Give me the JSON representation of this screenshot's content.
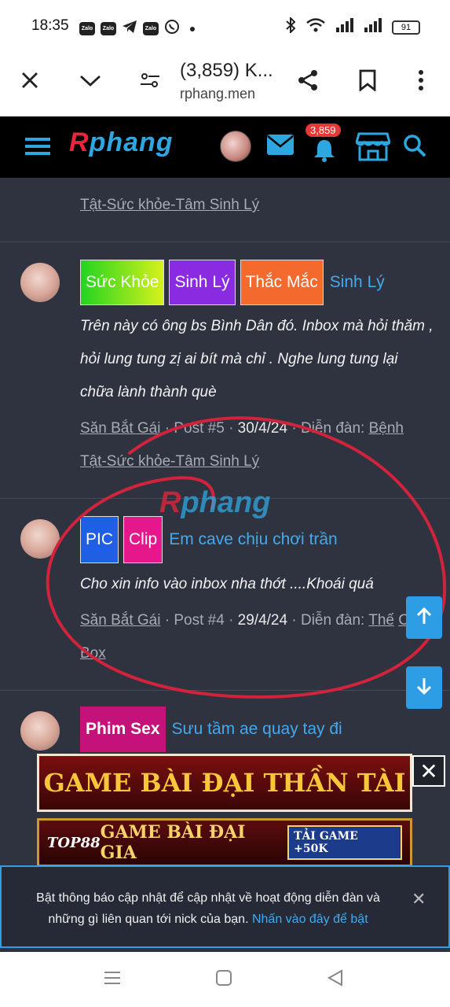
{
  "status_bar": {
    "time": "18:35",
    "app_icons": [
      "zalo-icon",
      "zalo-icon",
      "telegram-icon",
      "zalo-icon",
      "viber-icon"
    ],
    "app_labels": [
      "Zalo",
      "Zalo",
      "",
      "Zalo",
      ""
    ],
    "battery": "91"
  },
  "browser": {
    "title": "(3,859) K...",
    "url": "rphang.men"
  },
  "site_header": {
    "logo_r": "R",
    "logo_rest": "phang",
    "notification_count": "3,859"
  },
  "posts": [
    {
      "meta_link": "Tật-Sức khỏe-Tâm Sinh Lý"
    },
    {
      "tags": [
        {
          "label": "Sức Khỏe",
          "color": "#6fdc1e"
        },
        {
          "label": "Sinh Lý",
          "color": "#9b2fe0"
        },
        {
          "label": "Thắc Mắc",
          "color": "#f46a2e"
        }
      ],
      "thread_title": "Sinh Lý",
      "snippet": "Trên này có ông bs Bình Dân đó. Inbox mà hỏi thăm , hỏi lung tung zị ai bít mà chỉ . Nghe lung tung lại chữa lành thành què",
      "author": "Săn Bắt Gái",
      "post_no": "Post #5",
      "date": "30/4/24",
      "forum_label": "Diễn đàn:",
      "forum_line1": "Bệnh",
      "forum_line2": "Tật-Sức khỏe-Tâm Sinh Lý"
    },
    {
      "tags": [
        {
          "label": "PIC",
          "color": "#1f5fe6"
        },
        {
          "label": "Clip",
          "color": "#e6178a"
        }
      ],
      "thread_title": "Em cave chịu chơi trần",
      "snippet": "Cho xin info vào inbox nha thớt ....Khoái quá",
      "author": "Săn Bắt Gái",
      "post_no": "Post #4",
      "date": "29/4/24",
      "forum_label": "Diễn đàn:",
      "forum_line1": "Thế",
      "forum_line2": "Cẩm Box"
    },
    {
      "tags": [
        {
          "label": "Phim Sex",
          "color": "#c4127a"
        }
      ],
      "thread_title": "Sưu tầm ae quay tay đi"
    }
  ],
  "watermark": {
    "r": "R",
    "rest": "phang"
  },
  "ads": {
    "banner1": "GAME BÀI ĐẠI THẦN TÀI",
    "banner2_left": "TOP88",
    "banner2_mid": "GAME BÀI ĐẠI GIA",
    "banner2_right": "TẢI GAME +50K"
  },
  "notification": {
    "text": "Bật thông báo cập nhật để cập nhật về hoạt động diễn đàn và những gì liên quan tới nick của bạn.",
    "link": "Nhấn vào đây để bật"
  }
}
